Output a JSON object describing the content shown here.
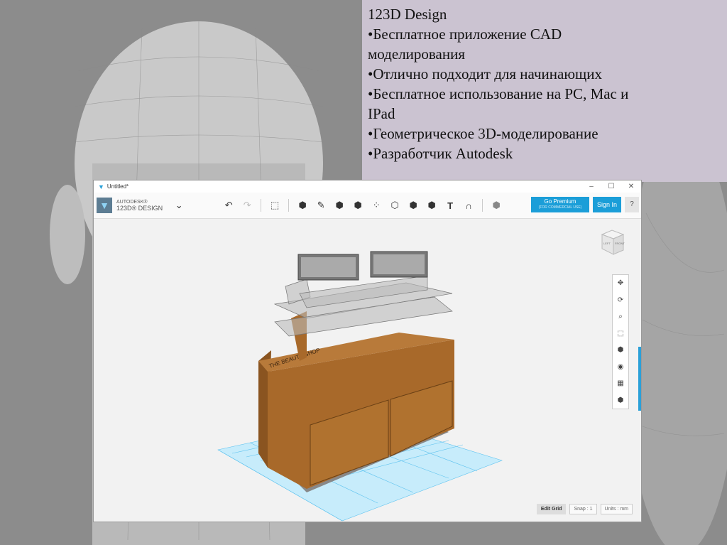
{
  "slide": {
    "lines": [
      "123D Design",
      "•Бесплатное приложение CAD",
      "моделирования",
      "•Отлично подходит для начинающих",
      "•Бесплатное использование на PC, Mac и",
      "IPad",
      "•Геометрическое 3D-моделирование",
      "•Разработчик Autodesk"
    ]
  },
  "window": {
    "title": "Untitled*",
    "controls": {
      "minimize": "–",
      "maximize": "☐",
      "close": "✕"
    }
  },
  "toolbar": {
    "brand_top": "AUTODESK®",
    "brand_bottom": "123D® DESIGN",
    "menu_chevron": "⌄",
    "undo": "↶",
    "redo": "↷",
    "text_tool": "T",
    "premium_label": "Go Premium",
    "premium_sub": "(FOR COMMERCIAL USE)",
    "signin_label": "Sign In",
    "help_label": "?"
  },
  "viewcube": {
    "left": "LEFT",
    "front": "FRONT"
  },
  "model": {
    "sign_text": "THE BEAUTY SHOP"
  },
  "status": {
    "edit_grid": "Edit Grid",
    "snap": "Snap : 1",
    "units": "Units : mm"
  },
  "colors": {
    "accent": "#1b9ed8",
    "wood": "#a8692a",
    "grid": "#5fc3ef"
  }
}
